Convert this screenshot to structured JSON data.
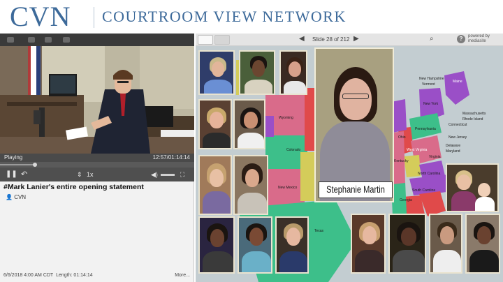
{
  "header": {
    "brand": "CVN",
    "brand_full": "COURTROOM VIEW NETWORK"
  },
  "player": {
    "status": "Playing",
    "time": "12:57/01:14:14",
    "speed": "1x",
    "progress_fraction": 0.18,
    "video_title": "#Mark Lanier's entire opening statement",
    "owner": "CVN",
    "footer_date": "6/6/2018   4:00 AM CDT",
    "footer_length": "Length: 01:14:14",
    "more_label": "More..."
  },
  "slides": {
    "slide_indicator": "Slide 28 of 212",
    "powered_by": "powered by mediasite",
    "help_label": "?",
    "featured_name": "Stephanie Martin",
    "state_labels": [
      "Wyoming",
      "Colorado",
      "New Mexico",
      "Texas",
      "New Hampshire",
      "Vermont",
      "Maine",
      "New York",
      "Massachusetts",
      "Rhode Island",
      "Connecticut",
      "Pennsylvania",
      "New Jersey",
      "Delaware",
      "Maryland",
      "Ohio",
      "West Virginia",
      "Virginia",
      "Kentucky",
      "North Carolina",
      "South Carolina",
      "Georgia"
    ]
  },
  "colors": {
    "brand": "#3d6a9a",
    "map_pink": "#d96b8a",
    "map_green": "#3dbf8a",
    "map_purple": "#9a4fc7",
    "map_yellow": "#d8d24a",
    "map_red": "#e04a4a"
  }
}
